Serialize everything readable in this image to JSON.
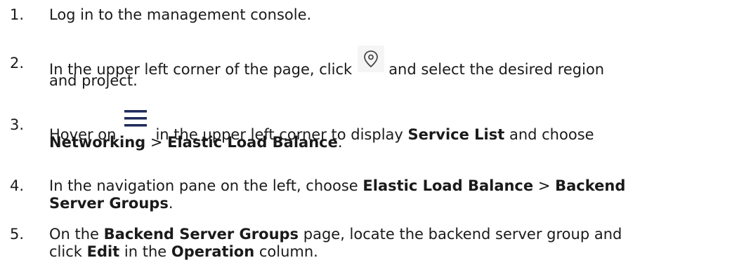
{
  "steps": [
    {
      "number": "1.",
      "line1": "Log in to the management console."
    },
    {
      "number": "2.",
      "line1_before": "In the upper left corner of the page, click",
      "icon": "location-pin-icon",
      "line1_after": "and select the desired region",
      "line2": "and project."
    },
    {
      "number": "3.",
      "line1_before": "Hover on",
      "icon": "hamburger-menu-icon",
      "line1_mid": "in the upper left corner to display",
      "bold1": "Service List",
      "line1_after": "and choose",
      "line2_bold1": "Networking",
      "line2_sep": " > ",
      "line2_bold2": "Elastic Load Balance",
      "line2_end": "."
    },
    {
      "number": "4.",
      "line1_before": "In the navigation pane on the left, choose",
      "bold1": "Elastic Load Balance",
      "sep": " > ",
      "bold2": "Backend",
      "line2_bold": "Server Groups",
      "line2_end": "."
    },
    {
      "number": "5.",
      "line1_before": "On the",
      "bold1": "Backend Server Groups",
      "line1_after": "page, locate the backend server group and",
      "line2_before": "click",
      "line2_bold1": "Edit",
      "line2_mid": "in the",
      "line2_bold2": "Operation",
      "line2_end": "column."
    }
  ],
  "colors": {
    "text": "#1a1a1a",
    "icon_stroke": "#4a4a4a",
    "menu_icon": "#1e2a5a",
    "icon_bg": "#f5f5f5"
  }
}
